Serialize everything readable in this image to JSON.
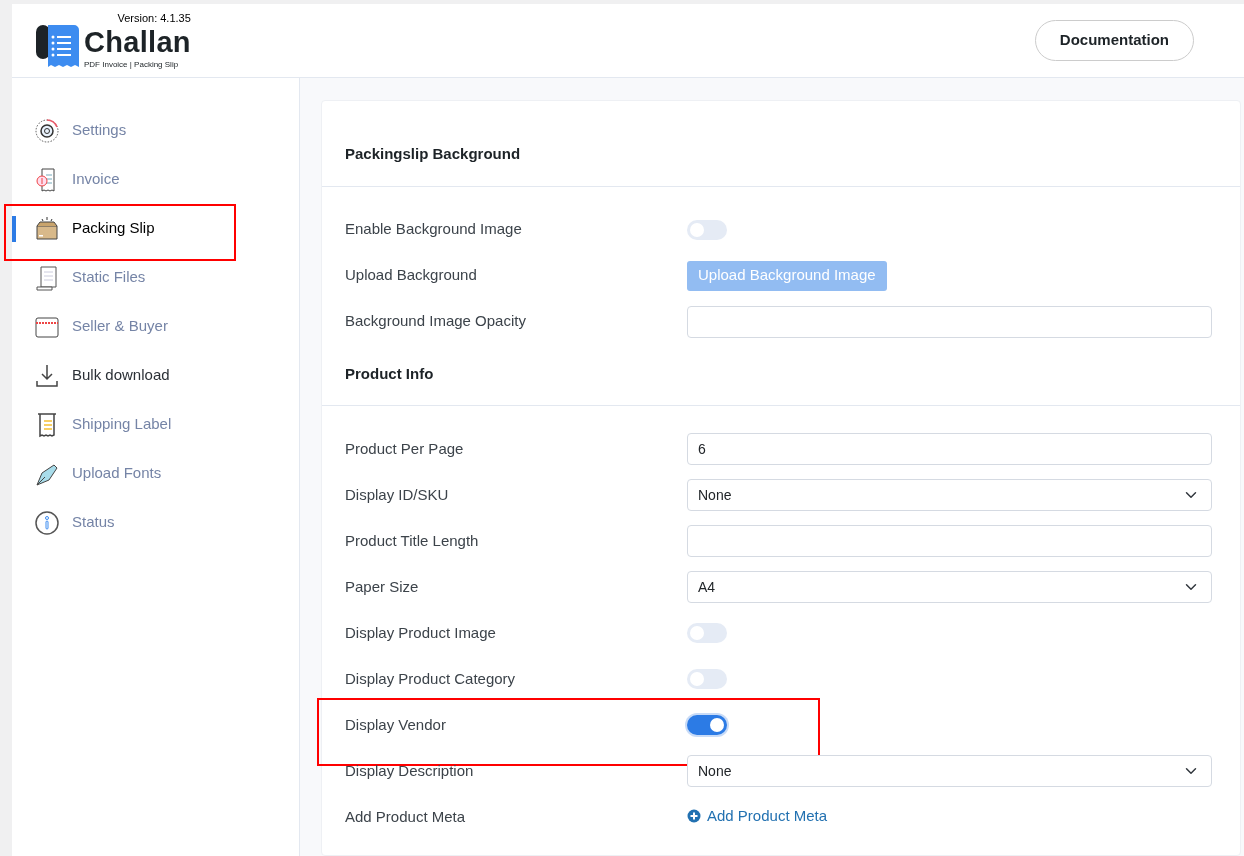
{
  "header": {
    "version": "Version: 4.1.35",
    "logo_name": "Challan",
    "logo_tagline": "PDF Invoice | Packing Slip",
    "doc_button": "Documentation"
  },
  "sidebar": {
    "items": [
      {
        "label": "Settings",
        "selected": false,
        "hovered": false,
        "highlighted": false
      },
      {
        "label": "Invoice",
        "selected": false,
        "hovered": false,
        "highlighted": false
      },
      {
        "label": "Packing Slip",
        "selected": true,
        "hovered": false,
        "highlighted": true
      },
      {
        "label": "Static Files",
        "selected": false,
        "hovered": false,
        "highlighted": false
      },
      {
        "label": "Seller & Buyer",
        "selected": false,
        "hovered": false,
        "highlighted": false
      },
      {
        "label": "Bulk download",
        "selected": false,
        "hovered": true,
        "highlighted": false
      },
      {
        "label": "Shipping Label",
        "selected": false,
        "hovered": false,
        "highlighted": false
      },
      {
        "label": "Upload Fonts",
        "selected": false,
        "hovered": false,
        "highlighted": false
      },
      {
        "label": "Status",
        "selected": false,
        "hovered": false,
        "highlighted": false
      }
    ]
  },
  "sections": [
    {
      "title": "Packingslip Background",
      "rows": [
        {
          "label": "Enable Background Image",
          "kind": "toggle",
          "on": false,
          "highlighted": false
        },
        {
          "label": "Upload Background",
          "kind": "button",
          "text": "Upload Background Image",
          "disabled": true,
          "highlighted": false
        },
        {
          "label": "Background Image Opacity",
          "kind": "input",
          "highlighted": false
        }
      ]
    },
    {
      "title": "Product Info",
      "rows": [
        {
          "label": "Product Per Page",
          "kind": "input",
          "value": "6",
          "highlighted": false
        },
        {
          "label": "Display ID/SKU",
          "kind": "select",
          "value": "None",
          "highlighted": false
        },
        {
          "label": "Product Title Length",
          "kind": "input",
          "highlighted": false
        },
        {
          "label": "Paper Size",
          "kind": "select",
          "value": "A4",
          "highlighted": false
        },
        {
          "label": "Display Product Image",
          "kind": "toggle",
          "on": false,
          "highlighted": false
        },
        {
          "label": "Display Product Category",
          "kind": "toggle",
          "on": false,
          "highlighted": false
        },
        {
          "label": "Display Vendor",
          "kind": "toggle",
          "on": true,
          "highlighted": true
        },
        {
          "label": "Display Description",
          "kind": "select",
          "value": "None",
          "highlighted": false
        },
        {
          "label": "Add Product Meta",
          "kind": "link",
          "text": "Add Product Meta",
          "highlighted": false
        }
      ]
    }
  ]
}
